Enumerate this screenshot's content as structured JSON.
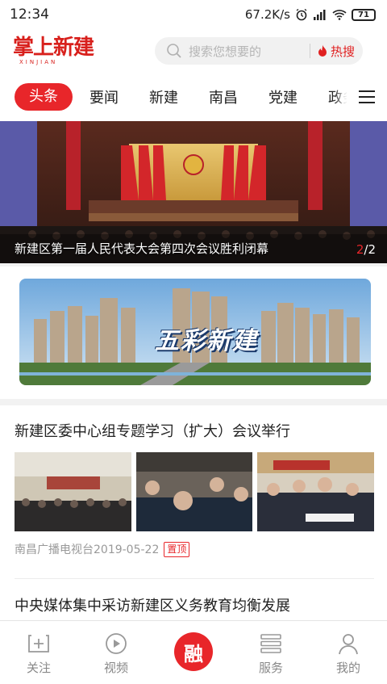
{
  "status_bar": {
    "time": "12:34",
    "network_speed": "67.2K/s",
    "battery": "71"
  },
  "header": {
    "logo_text": "掌上新建",
    "logo_sub": "XINJIAN",
    "search_placeholder": "搜索您想要的",
    "hot_search_label": "热搜"
  },
  "tabs": [
    {
      "label": "头条",
      "active": true
    },
    {
      "label": "要闻",
      "active": false
    },
    {
      "label": "新建",
      "active": false
    },
    {
      "label": "南昌",
      "active": false
    },
    {
      "label": "党建",
      "active": false
    },
    {
      "label": "政务",
      "active": false
    }
  ],
  "banner": {
    "caption": "新建区第一届人民代表大会第四次会议胜利闭幕",
    "current": "2",
    "total": "/2"
  },
  "ad": {
    "text": "五彩新建"
  },
  "articles": [
    {
      "title": "新建区委中心组专题学习（扩大）会议举行",
      "source_date": "南昌广播电视台2019-05-22",
      "badge": "置顶"
    },
    {
      "title": "中央媒体集中采访新建区义务教育均衡发展"
    }
  ],
  "bottom_nav": {
    "items": [
      {
        "label": "关注",
        "icon": "follow-plus-icon"
      },
      {
        "label": "视频",
        "icon": "play-circle-icon"
      },
      {
        "label": "融",
        "icon": "center-fab"
      },
      {
        "label": "服务",
        "icon": "list-icon"
      },
      {
        "label": "我的",
        "icon": "user-icon"
      }
    ]
  },
  "colors": {
    "accent": "#e8262a",
    "text": "#222222",
    "muted": "#999999"
  }
}
